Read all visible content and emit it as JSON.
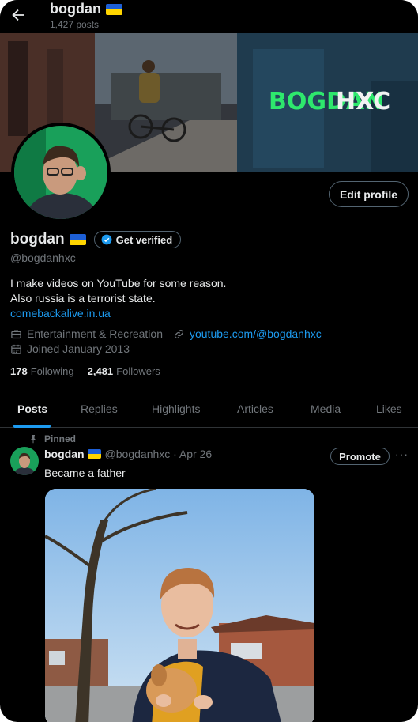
{
  "header": {
    "name": "bogdan",
    "posts_count": "1,427 posts",
    "back_icon": "arrow-left-icon"
  },
  "banner": {
    "text": "BOGDAN HXC",
    "accent": "#2ee86d"
  },
  "profile": {
    "display_name": "bogdan",
    "get_verified": "Get verified",
    "handle": "@bogdanhxc",
    "edit_profile": "Edit profile",
    "bio_line1": "I make videos on YouTube for some reason.",
    "bio_line2": "Also russia is a terrorist state.",
    "bio_link": "comebackalive.in.ua",
    "category": "Entertainment & Recreation",
    "website": "youtube.com/@bogdanhxc",
    "joined": "Joined January 2013",
    "following_count": "178",
    "following_label": "Following",
    "followers_count": "2,481",
    "followers_label": "Followers"
  },
  "tabs": [
    {
      "label": "Posts",
      "active": true
    },
    {
      "label": "Replies",
      "active": false
    },
    {
      "label": "Highlights",
      "active": false
    },
    {
      "label": "Articles",
      "active": false
    },
    {
      "label": "Media",
      "active": false
    },
    {
      "label": "Likes",
      "active": false
    }
  ],
  "post": {
    "pinned_label": "Pinned",
    "author": "bogdan",
    "handle_date": "@bogdanhxc · Apr 26",
    "text": "Became a father",
    "promote": "Promote",
    "more": "···"
  },
  "colors": {
    "background": "#000000",
    "accent_blue": "#1d9bf0",
    "muted": "#71767b",
    "border": "#2f3336",
    "flag_blue": "#1d5fd6",
    "flag_yellow": "#ffd500"
  }
}
